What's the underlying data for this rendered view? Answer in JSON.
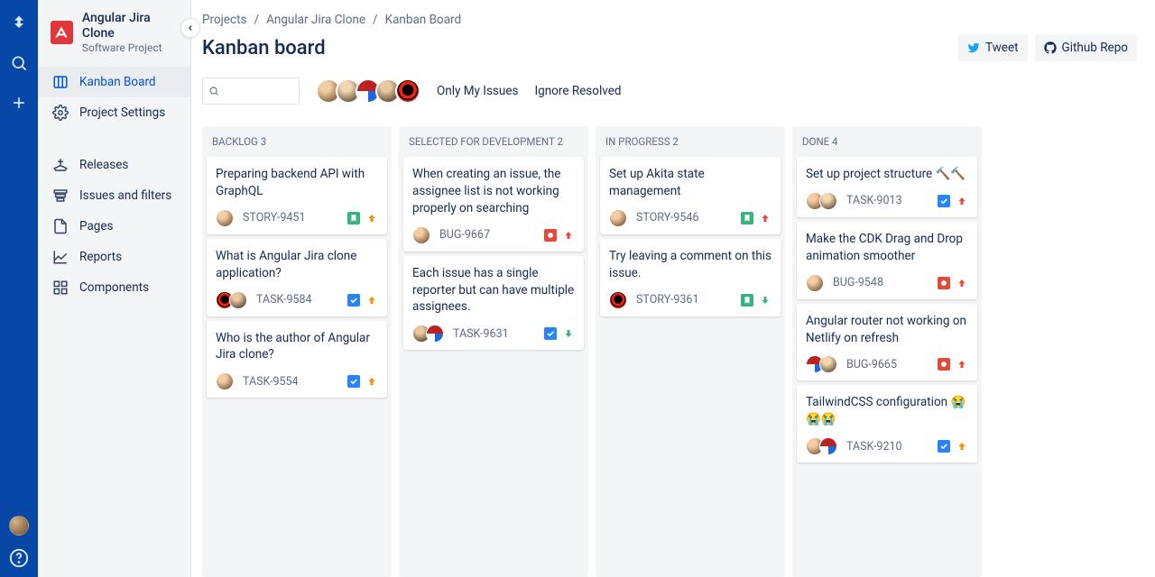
{
  "project": {
    "name": "Angular Jira Clone",
    "subtitle": "Software Project"
  },
  "sidebar": {
    "items": [
      {
        "label": "Kanban Board"
      },
      {
        "label": "Project Settings"
      },
      {
        "label": "Releases"
      },
      {
        "label": "Issues and filters"
      },
      {
        "label": "Pages"
      },
      {
        "label": "Reports"
      },
      {
        "label": "Components"
      }
    ]
  },
  "breadcrumb": [
    "Projects",
    "Angular Jira Clone",
    "Kanban Board"
  ],
  "page_title": "Kanban board",
  "actions": {
    "tweet": "Tweet",
    "github": "Github Repo"
  },
  "filters": {
    "only_mine": "Only My Issues",
    "ignore_resolved": "Ignore Resolved",
    "search_placeholder": ""
  },
  "columns": [
    {
      "title": "BACKLOG 3",
      "cards": [
        {
          "title": "Preparing backend API with GraphQL",
          "key": "STORY-9451",
          "type": "story",
          "priority": "up-orange",
          "avatars": [
            1
          ]
        },
        {
          "title": "What is Angular Jira clone application?",
          "key": "TASK-9584",
          "type": "task",
          "priority": "up-orange",
          "avatars": [
            5,
            4
          ]
        },
        {
          "title": "Who is the author of Angular Jira clone?",
          "key": "TASK-9554",
          "type": "task",
          "priority": "up-orange",
          "avatars": [
            1
          ]
        }
      ]
    },
    {
      "title": "SELECTED FOR DEVELOPMENT 2",
      "cards": [
        {
          "title": "When creating an issue, the assignee list is not working properly on searching",
          "key": "BUG-9667",
          "type": "bug",
          "priority": "up-red",
          "avatars": [
            1
          ]
        },
        {
          "title": "Each issue has a single reporter but can have multiple assignees.",
          "key": "TASK-9631",
          "type": "task",
          "priority": "down-green",
          "avatars": [
            4,
            3
          ]
        }
      ]
    },
    {
      "title": "IN PROGRESS 2",
      "cards": [
        {
          "title": "Set up Akita state management",
          "key": "STORY-9546",
          "type": "story",
          "priority": "up-red",
          "avatars": [
            1
          ]
        },
        {
          "title": "Try leaving a comment on this issue.",
          "key": "STORY-9361",
          "type": "story",
          "priority": "down-green",
          "avatars": [
            5
          ]
        }
      ]
    },
    {
      "title": "DONE 4",
      "cards": [
        {
          "title": "Set up project structure 🔨🔨",
          "key": "TASK-9013",
          "type": "task",
          "priority": "up-red",
          "avatars": [
            1,
            2
          ]
        },
        {
          "title": "Make the CDK Drag and Drop animation smoother",
          "key": "BUG-9548",
          "type": "bug",
          "priority": "up-red",
          "avatars": [
            1
          ]
        },
        {
          "title": "Angular router not working on Netlify on refresh",
          "key": "BUG-9665",
          "type": "bug",
          "priority": "up-red",
          "avatars": [
            3,
            2
          ]
        },
        {
          "title": "TailwindCSS configuration 😭😭😭",
          "key": "TASK-9210",
          "type": "task",
          "priority": "up-orange",
          "avatars": [
            1,
            3
          ]
        }
      ]
    }
  ]
}
